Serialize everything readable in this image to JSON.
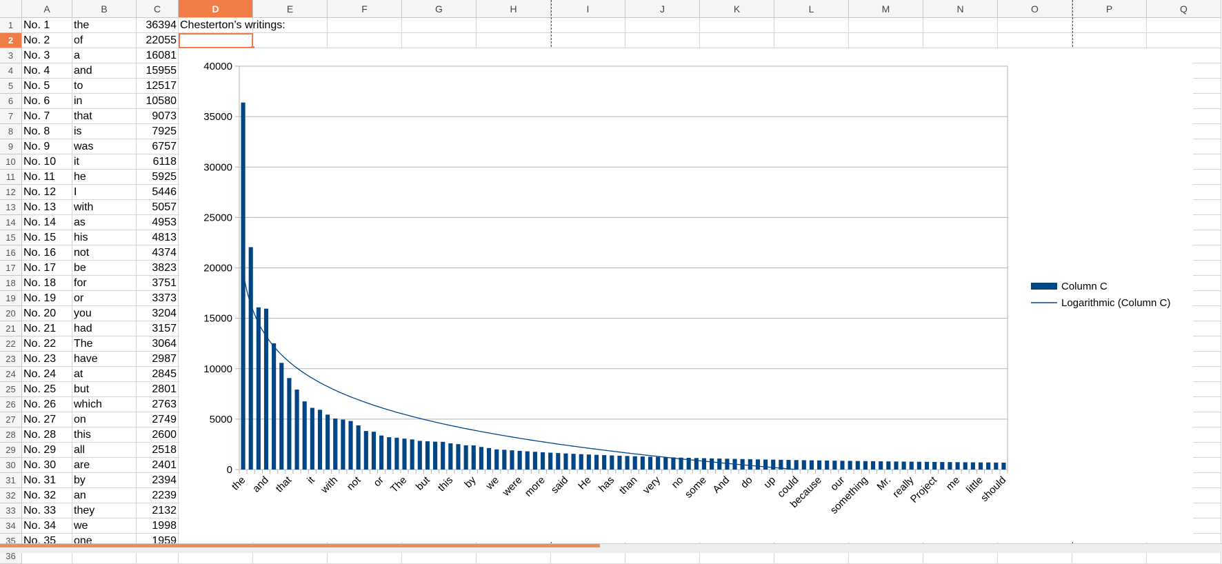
{
  "columns": [
    "A",
    "B",
    "C",
    "D",
    "E",
    "F",
    "G",
    "H",
    "I",
    "J",
    "K",
    "L",
    "M",
    "N",
    "O",
    "P",
    "Q"
  ],
  "selected_column": "D",
  "selected_row": 2,
  "d1_text": "Chesterton’s writings:",
  "rows": [
    [
      "No. 1",
      "the",
      36394
    ],
    [
      "No. 2",
      "of",
      22055
    ],
    [
      "No. 3",
      "a",
      16081
    ],
    [
      "No. 4",
      "and",
      15955
    ],
    [
      "No. 5",
      "to",
      12517
    ],
    [
      "No. 6",
      "in",
      10580
    ],
    [
      "No. 7",
      "that",
      9073
    ],
    [
      "No. 8",
      "is",
      7925
    ],
    [
      "No. 9",
      "was",
      6757
    ],
    [
      "No. 10",
      "it",
      6118
    ],
    [
      "No. 11",
      "he",
      5925
    ],
    [
      "No. 12",
      "I",
      5446
    ],
    [
      "No. 13",
      "with",
      5057
    ],
    [
      "No. 14",
      "as",
      4953
    ],
    [
      "No. 15",
      "his",
      4813
    ],
    [
      "No. 16",
      "not",
      4374
    ],
    [
      "No. 17",
      "be",
      3823
    ],
    [
      "No. 18",
      "for",
      3751
    ],
    [
      "No. 19",
      "or",
      3373
    ],
    [
      "No. 20",
      "you",
      3204
    ],
    [
      "No. 21",
      "had",
      3157
    ],
    [
      "No. 22",
      "The",
      3064
    ],
    [
      "No. 23",
      "have",
      2987
    ],
    [
      "No. 24",
      "at",
      2845
    ],
    [
      "No. 25",
      "but",
      2801
    ],
    [
      "No. 26",
      "which",
      2763
    ],
    [
      "No. 27",
      "on",
      2749
    ],
    [
      "No. 28",
      "this",
      2600
    ],
    [
      "No. 29",
      "all",
      2518
    ],
    [
      "No. 30",
      "are",
      2401
    ],
    [
      "No. 31",
      "by",
      2394
    ],
    [
      "No. 32",
      "an",
      2239
    ],
    [
      "No. 33",
      "they",
      2132
    ],
    [
      "No. 34",
      "we",
      1998
    ],
    [
      "No. 35",
      "one",
      1959
    ]
  ],
  "chart_data": {
    "type": "bar",
    "ylim": [
      0,
      40000
    ],
    "yticks": [
      0,
      5000,
      10000,
      15000,
      20000,
      25000,
      30000,
      35000,
      40000
    ],
    "grid": true,
    "legend_position": "right",
    "bar_color": "#004586",
    "x_tick_labels": {
      "1": "the",
      "4": "and",
      "7": "that",
      "10": "it",
      "13": "with",
      "16": "not",
      "19": "or",
      "22": "The",
      "25": "but",
      "28": "this",
      "31": "by",
      "34": "we",
      "37": "were",
      "40": "more",
      "43": "said",
      "46": "He",
      "49": "has",
      "52": "than",
      "55": "very",
      "58": "no",
      "61": "some",
      "64": "And",
      "67": "do",
      "70": "up",
      "73": "could",
      "76": "because",
      "79": "our",
      "82": "something",
      "85": "Mr.",
      "88": "really",
      "91": "Project",
      "94": "me",
      "97": "little",
      "100": "should"
    },
    "values": [
      36394,
      22055,
      16081,
      15955,
      12517,
      10580,
      9073,
      7925,
      6757,
      6118,
      5925,
      5446,
      5057,
      4953,
      4813,
      4374,
      3823,
      3751,
      3373,
      3204,
      3157,
      3064,
      2987,
      2845,
      2801,
      2763,
      2749,
      2600,
      2518,
      2401,
      2394,
      2239,
      2132,
      1998,
      1959,
      1906,
      1854,
      1805,
      1759,
      1715,
      1673,
      1633,
      1595,
      1559,
      1524,
      1491,
      1460,
      1429,
      1400,
      1372,
      1345,
      1319,
      1294,
      1270,
      1247,
      1225,
      1204,
      1183,
      1163,
      1143,
      1125,
      1106,
      1089,
      1072,
      1055,
      1039,
      1024,
      1009,
      994,
      980,
      966,
      953,
      940,
      927,
      915,
      903,
      891,
      879,
      868,
      858,
      847,
      837,
      827,
      817,
      807,
      798,
      789,
      780,
      771,
      762,
      754,
      746,
      738,
      730,
      722,
      715,
      707,
      700,
      693,
      686
    ],
    "series": [
      {
        "name": "Column C",
        "kind": "bar"
      },
      {
        "name": "Logarithmic (Column C)",
        "kind": "trendline-logarithmic"
      }
    ]
  }
}
